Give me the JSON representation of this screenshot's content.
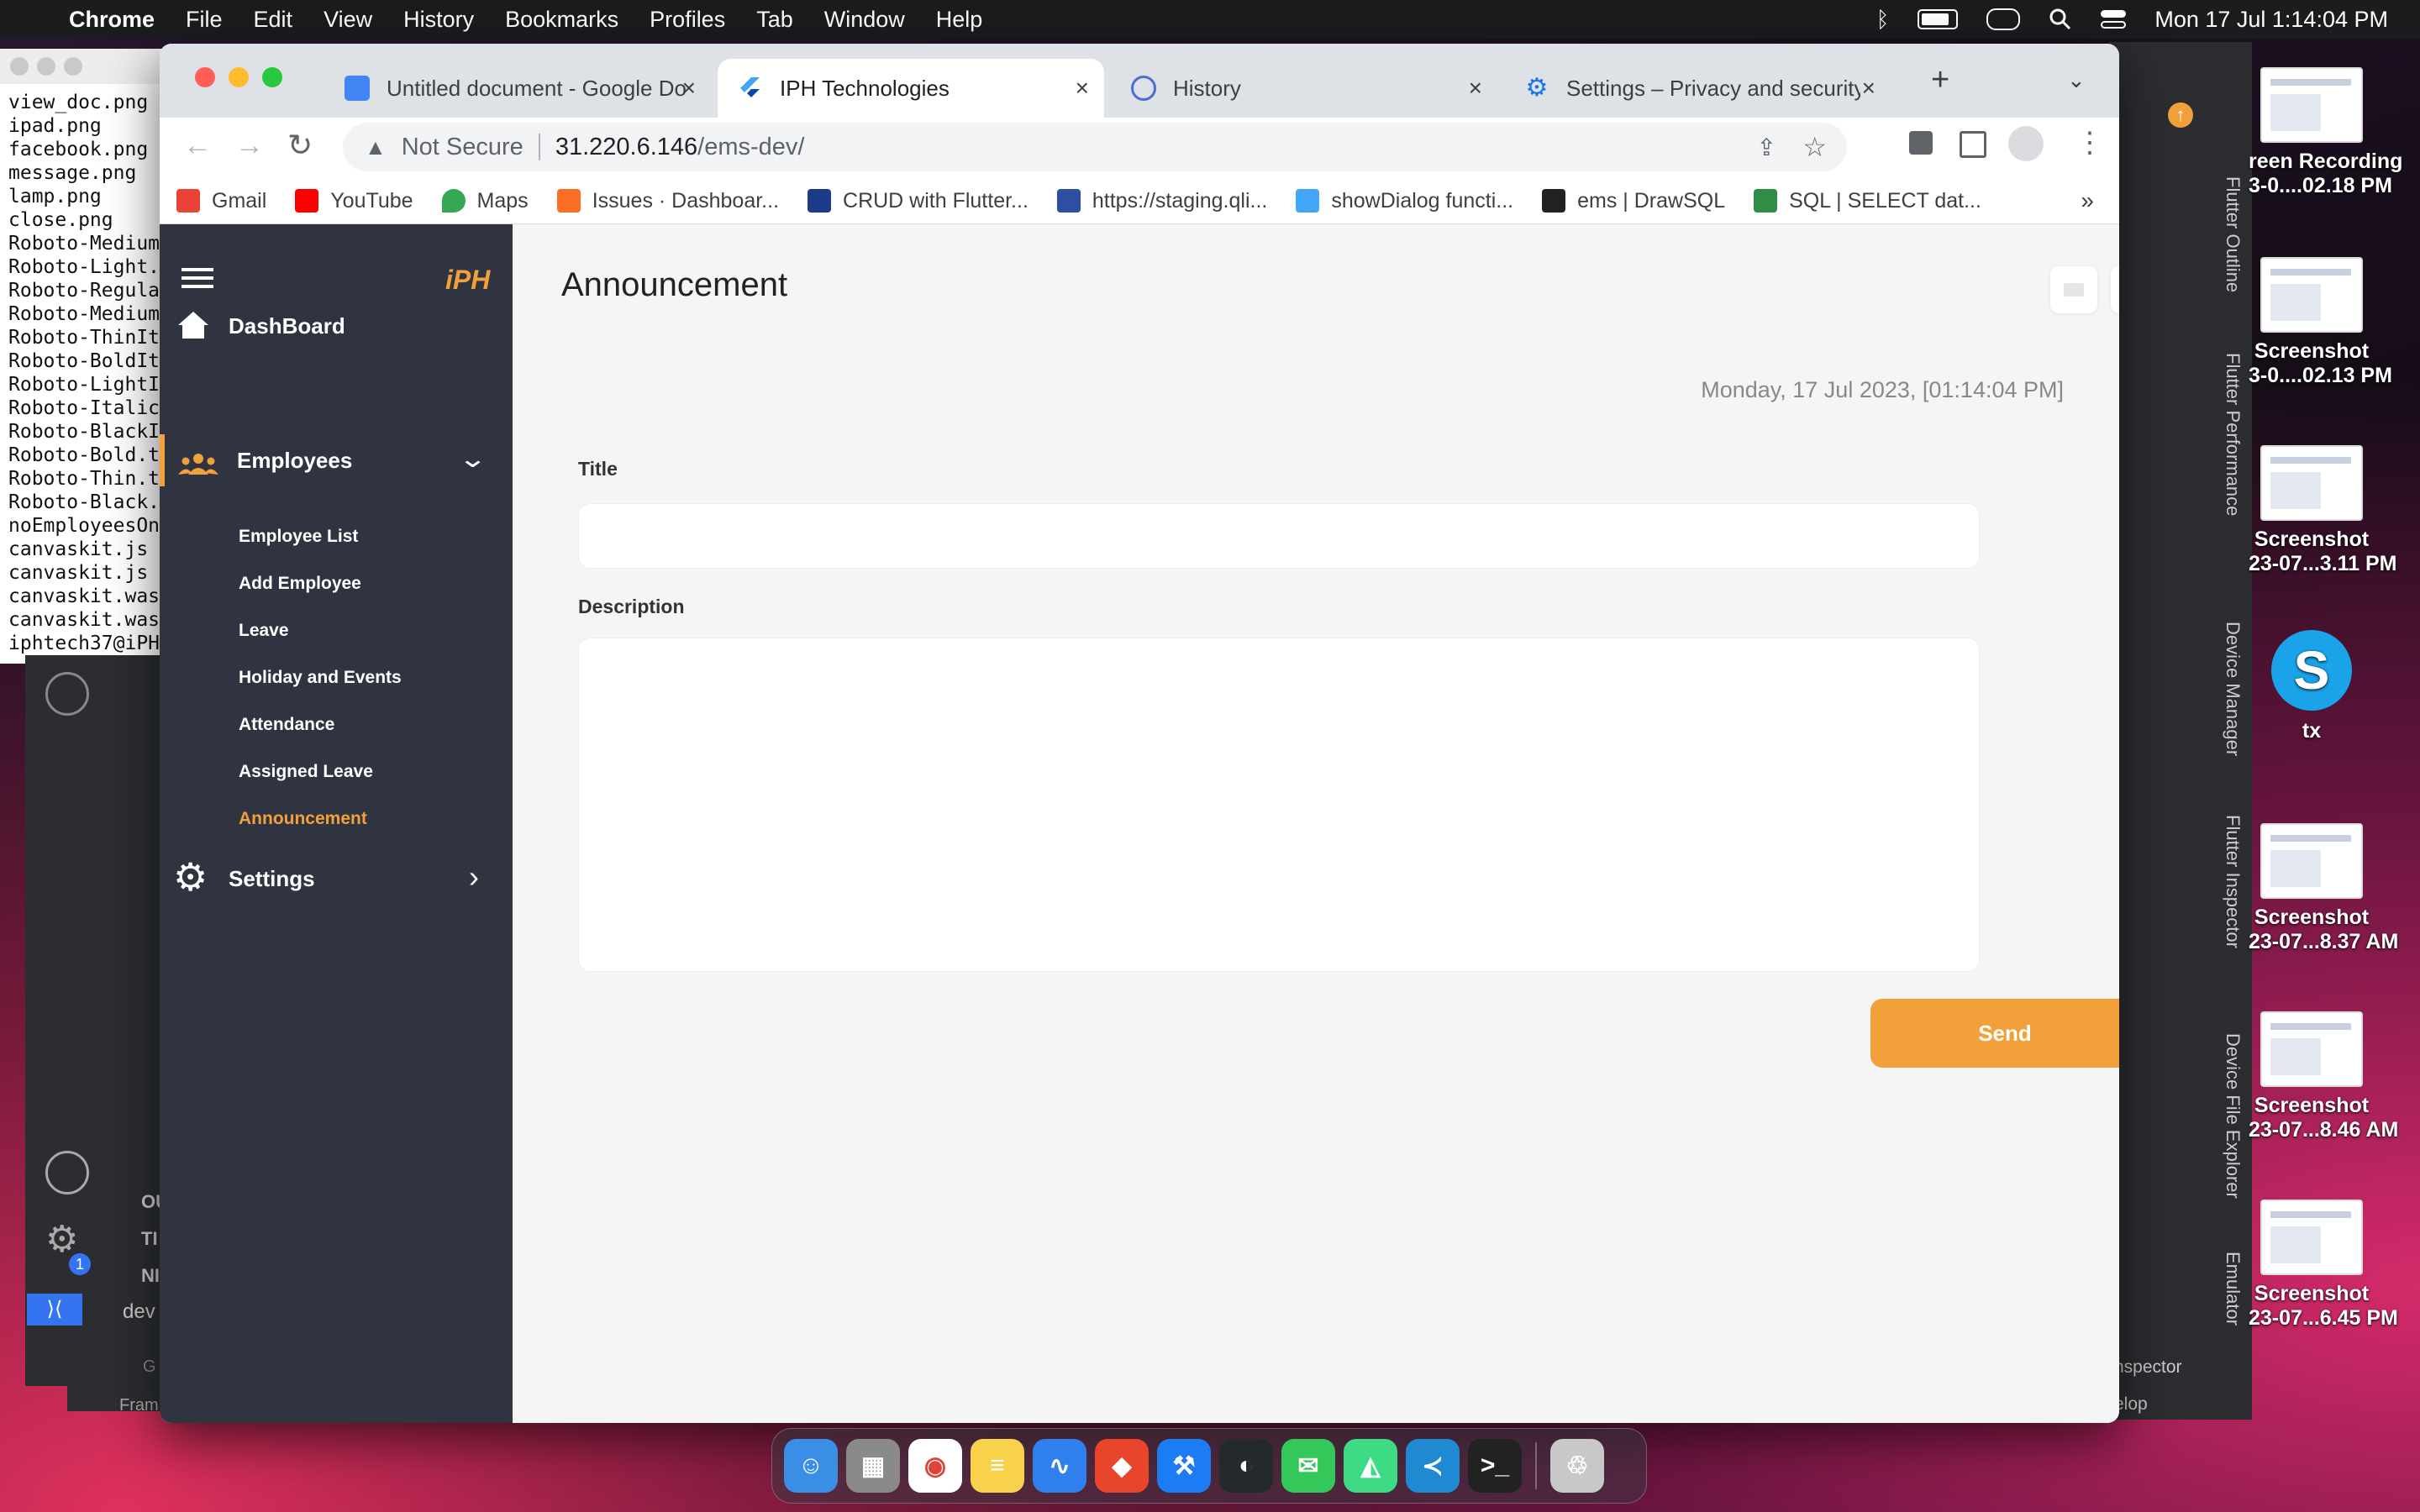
{
  "menubar": {
    "app": "Chrome",
    "items": [
      "File",
      "Edit",
      "View",
      "History",
      "Bookmarks",
      "Profiles",
      "Tab",
      "Window",
      "Help"
    ],
    "datetime": "Mon 17 Jul  1:14:04 PM"
  },
  "terminal": {
    "lines": [
      "view_doc.png",
      "ipad.png",
      "facebook.png",
      "message.png",
      "lamp.png",
      "close.png",
      "Roboto-Medium",
      "Roboto-Light.",
      "Roboto-Regula",
      "Roboto-Medium",
      "Roboto-ThinIt",
      "Roboto-BoldIt",
      "Roboto-LightI",
      "Roboto-Italic",
      "Roboto-BlackI",
      "Roboto-Bold.t",
      "Roboto-Thin.t",
      "Roboto-Black.",
      "noEmployeesOn",
      "canvaskit.js",
      "canvaskit.js",
      "canvaskit.was",
      "canvaskit.was",
      "iphtech37@iPH"
    ]
  },
  "ide": {
    "right_tabs": [
      "Flutter Outline",
      "Flutter Performance",
      "Device Manager",
      "Flutter Inspector",
      "Device File Explorer",
      "Emulator"
    ],
    "left_items": [
      "OU",
      "TI",
      "NI"
    ],
    "branch": "dev",
    "bottom_left": [
      "G",
      "Fram"
    ],
    "bottom_right": [
      "nspector",
      "elop"
    ],
    "badge": "1"
  },
  "desktop": {
    "items": [
      {
        "label1": "reen Recording",
        "label2": "3-0....02.18 PM"
      },
      {
        "label1": "Screenshot",
        "label2": "3-0....02.13 PM"
      },
      {
        "label1": "Screenshot",
        "label2": "23-07...3.11 PM"
      },
      {
        "label1": "tx",
        "label2": ""
      },
      {
        "label1": "Screenshot",
        "label2": "23-07...8.37 AM"
      },
      {
        "label1": "Screenshot",
        "label2": "23-07...8.46 AM"
      },
      {
        "label1": "Screenshot",
        "label2": "23-07...6.45 PM"
      }
    ]
  },
  "browser": {
    "tabs": [
      {
        "title": "Untitled document - Google Do"
      },
      {
        "title": "IPH Technologies"
      },
      {
        "title": "History"
      },
      {
        "title": "Settings – Privacy and security"
      }
    ],
    "security_label": "Not Secure",
    "url_host": "31.220.6.146",
    "url_path": "/ems-dev/",
    "bookmarks": [
      "Gmail",
      "YouTube",
      "Maps",
      "Issues · Dashboar...",
      "CRUD with Flutter...",
      "https://staging.qli...",
      "showDialog functi...",
      "ems | DrawSQL",
      "SQL | SELECT dat..."
    ],
    "more": "»"
  },
  "app": {
    "logo": "iPH",
    "sidebar": {
      "dashboard": "DashBoard",
      "employees": "Employees",
      "sub_items": [
        "Employee List",
        "Add Employee",
        "Leave",
        "Holiday and Events",
        "Attendance",
        "Assigned Leave",
        "Announcement"
      ],
      "active_item": "Announcement",
      "settings": "Settings"
    },
    "page_title": "Announcement",
    "datetime": "Monday, 17 Jul 2023, [01:14:04 PM]",
    "title_label": "Title",
    "title_value": "",
    "description_label": "Description",
    "description_value": "",
    "send_label": "Send",
    "accent_color": "#f2a13a",
    "sidebar_color": "#2f3440"
  },
  "dock": {
    "apps": [
      "Finder",
      "Launchpad",
      "Chrome",
      "Notes",
      "Freeform",
      "AnyDesk",
      "Xcode",
      "GitHub Desktop",
      "Messages",
      "Android Studio",
      "VS Code",
      "Terminal",
      "Trash"
    ]
  }
}
